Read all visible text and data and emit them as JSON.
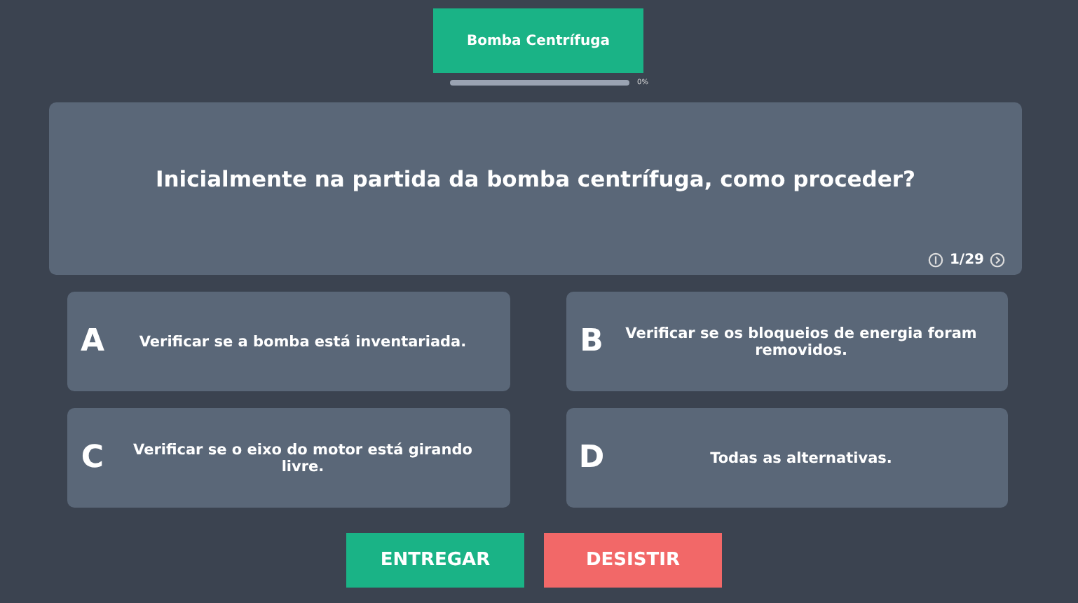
{
  "topic": {
    "label": "Bomba Centrífuga"
  },
  "progress": {
    "level": 0,
    "reading": "0%"
  },
  "question": {
    "text": "Inicialmente na partida da bomba centrífuga, como proceder?",
    "counter": "1/29"
  },
  "options": [
    {
      "letter": "A",
      "text": "Verificar se a bomba está inventariada.",
      "selected": false
    },
    {
      "letter": "B",
      "text": "Verificar se os bloqueios de energia foram removidos.",
      "selected": false
    },
    {
      "letter": "C",
      "text": "Verificar se o eixo do motor está girando livre.",
      "selected": false
    },
    {
      "letter": "D",
      "text": "Todas as alternativas.",
      "selected": false
    }
  ],
  "buttons": [
    {
      "label": "ENTREGAR",
      "kind": "submit"
    },
    {
      "label": "DESISTIR",
      "kind": "quit"
    }
  ]
}
